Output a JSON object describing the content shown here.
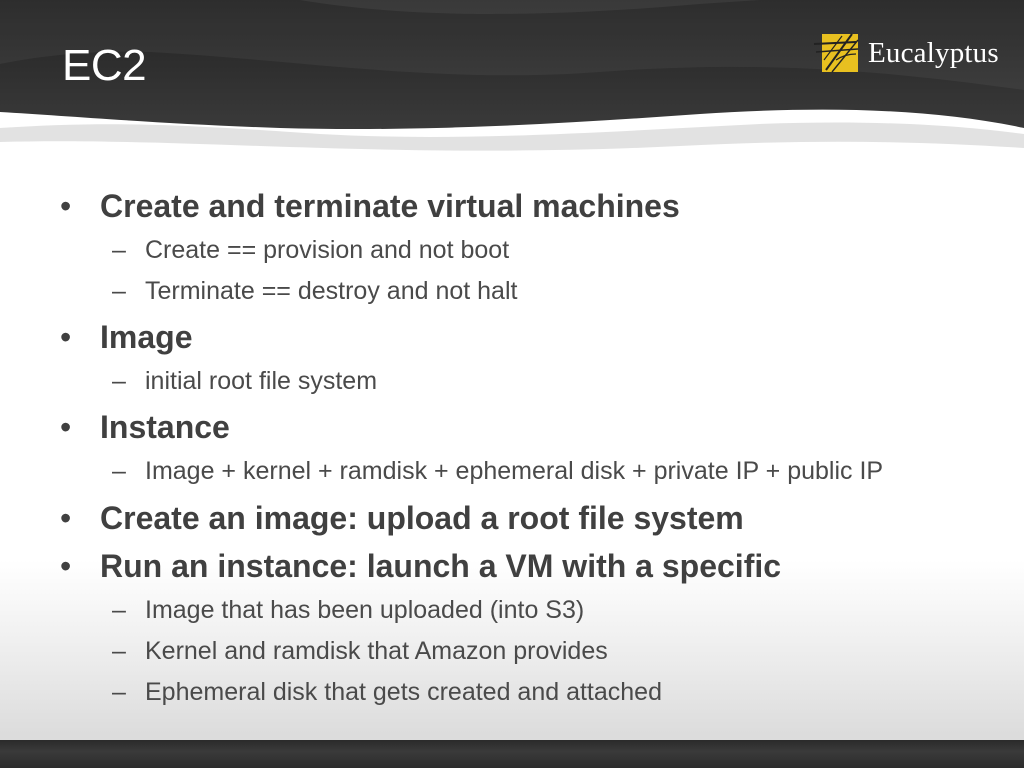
{
  "slide": {
    "title": "EC2",
    "logo": {
      "name": "Eucalyptus",
      "icon": "eucalyptus-leaf-icon",
      "colors": {
        "gold": "#e8c020",
        "dark": "#222222"
      }
    },
    "bullet_glyph": "•",
    "dash_glyph": "–",
    "items": [
      {
        "text": "Create and terminate virtual machines",
        "subs": [
          "Create == provision and not boot",
          "Terminate == destroy and not halt"
        ]
      },
      {
        "text": "Image",
        "subs": [
          "initial root file system"
        ]
      },
      {
        "text": "Instance",
        "subs": [
          "Image + kernel + ramdisk + ephemeral disk + private IP + public IP"
        ]
      },
      {
        "text": "Create an image: upload a root file system",
        "subs": []
      },
      {
        "text": "Run an instance: launch a VM with a specific",
        "subs": [
          "Image that has been uploaded (into S3)",
          "Kernel and ramdisk that Amazon provides",
          "Ephemeral disk that gets created and attached"
        ]
      }
    ]
  },
  "colors": {
    "header_dark": "#2e2e2e",
    "body_text": "#404040",
    "title_text": "#ffffff"
  }
}
